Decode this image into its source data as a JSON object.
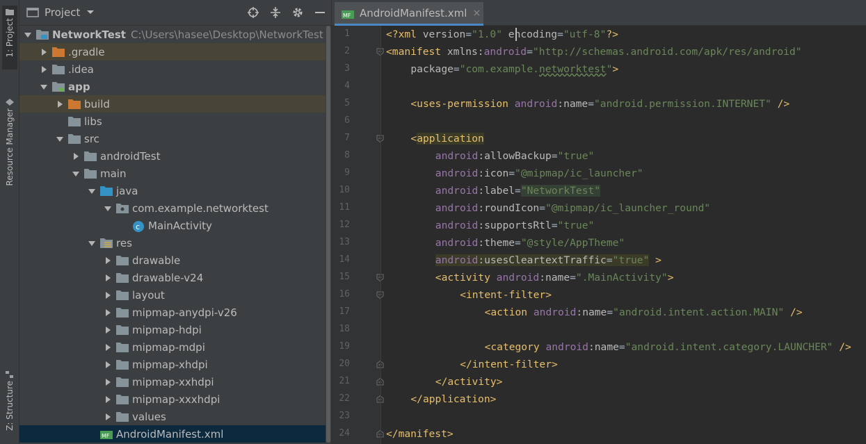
{
  "strip": {
    "project_tab": "1: Project",
    "resource_tab": "Resource Manager",
    "structure_tab": "Z: Structure"
  },
  "project_panel": {
    "title": "Project",
    "icons": [
      "target-icon",
      "collapse-icon",
      "gear-icon",
      "minimize-icon"
    ],
    "tree": [
      {
        "label": "NetworkTest",
        "path": "C:\\Users\\hasee\\Desktop\\NetworkTest",
        "depth": 0,
        "arrow": "down",
        "icon": "module-folder",
        "bold": true
      },
      {
        "label": ".gradle",
        "depth": 1,
        "arrow": "right",
        "icon": "orange-folder",
        "highlight": true
      },
      {
        "label": ".idea",
        "depth": 1,
        "arrow": "right",
        "icon": "folder"
      },
      {
        "label": "app",
        "depth": 1,
        "arrow": "down",
        "icon": "module-folder-green",
        "bold": true
      },
      {
        "label": "build",
        "depth": 2,
        "arrow": "right",
        "icon": "orange-folder",
        "highlight": true
      },
      {
        "label": "libs",
        "depth": 2,
        "arrow": "none",
        "icon": "folder"
      },
      {
        "label": "src",
        "depth": 2,
        "arrow": "down",
        "icon": "folder"
      },
      {
        "label": "androidTest",
        "depth": 3,
        "arrow": "right",
        "icon": "folder"
      },
      {
        "label": "main",
        "depth": 3,
        "arrow": "down",
        "icon": "folder"
      },
      {
        "label": "java",
        "depth": 4,
        "arrow": "down",
        "icon": "blue-folder"
      },
      {
        "label": "com.example.networktest",
        "depth": 5,
        "arrow": "down",
        "icon": "package-folder"
      },
      {
        "label": "MainActivity",
        "depth": 6,
        "arrow": "none",
        "icon": "class-c"
      },
      {
        "label": "res",
        "depth": 4,
        "arrow": "down",
        "icon": "res-folder"
      },
      {
        "label": "drawable",
        "depth": 5,
        "arrow": "right",
        "icon": "folder"
      },
      {
        "label": "drawable-v24",
        "depth": 5,
        "arrow": "right",
        "icon": "folder"
      },
      {
        "label": "layout",
        "depth": 5,
        "arrow": "right",
        "icon": "folder"
      },
      {
        "label": "mipmap-anydpi-v26",
        "depth": 5,
        "arrow": "right",
        "icon": "folder"
      },
      {
        "label": "mipmap-hdpi",
        "depth": 5,
        "arrow": "right",
        "icon": "folder"
      },
      {
        "label": "mipmap-mdpi",
        "depth": 5,
        "arrow": "right",
        "icon": "folder"
      },
      {
        "label": "mipmap-xhdpi",
        "depth": 5,
        "arrow": "right",
        "icon": "folder"
      },
      {
        "label": "mipmap-xxhdpi",
        "depth": 5,
        "arrow": "right",
        "icon": "folder"
      },
      {
        "label": "mipmap-xxxhdpi",
        "depth": 5,
        "arrow": "right",
        "icon": "folder"
      },
      {
        "label": "values",
        "depth": 5,
        "arrow": "right",
        "icon": "folder"
      },
      {
        "label": "AndroidManifest.xml",
        "depth": 4,
        "arrow": "none",
        "icon": "manifest",
        "selected": true
      }
    ]
  },
  "editor": {
    "tab": {
      "label": "AndroidManifest.xml",
      "close": "×",
      "badge": "MF"
    },
    "line_numbers": [
      "1",
      "2",
      "3",
      "4",
      "5",
      "6",
      "7",
      "8",
      "9",
      "10",
      "11",
      "12",
      "13",
      "14",
      "15",
      "16",
      "17",
      "18",
      "19",
      "20",
      "21",
      "22",
      "23",
      "24"
    ],
    "lines": [
      [
        [
          "p",
          "<?"
        ],
        [
          "t",
          "xml "
        ],
        [
          "at",
          "version"
        ],
        [
          "",
          "="
        ],
        [
          "v",
          "\"1.0\""
        ],
        [
          "",
          " "
        ],
        [
          "at",
          "encoding"
        ],
        [
          "",
          "="
        ],
        [
          "v",
          "\"utf-8\""
        ],
        [
          "p",
          "?>"
        ]
      ],
      [
        [
          "t",
          "<manifest "
        ],
        [
          "at",
          "xmlns:"
        ],
        [
          "ns",
          "android"
        ],
        [
          "",
          "="
        ],
        [
          "v",
          "\"http://schemas.android.com/apk/res/android\""
        ]
      ],
      [
        [
          "",
          " "
        ],
        [
          "at",
          "package"
        ],
        [
          "",
          "="
        ],
        [
          "v",
          "\"com.example."
        ],
        [
          "vul",
          "networktest"
        ],
        [
          "v",
          "\""
        ],
        [
          "t",
          ">"
        ]
      ],
      [],
      [
        [
          "",
          " "
        ],
        [
          "t",
          "<uses-permission "
        ],
        [
          "ns",
          "android"
        ],
        [
          "at",
          ":name"
        ],
        [
          "",
          "="
        ],
        [
          "v",
          "\"android.permission.INTERNET\""
        ],
        [
          "",
          " "
        ],
        [
          "t",
          "/>"
        ]
      ],
      [],
      [
        [
          "",
          " "
        ],
        [
          "t",
          "<"
        ],
        [
          "th",
          "application"
        ]
      ],
      [
        [
          "",
          " "
        ],
        [
          "ns",
          "android"
        ],
        [
          "at",
          ":allowBackup"
        ],
        [
          "",
          "="
        ],
        [
          "v",
          "\"true\""
        ]
      ],
      [
        [
          "",
          " "
        ],
        [
          "ns",
          "android"
        ],
        [
          "at",
          ":icon"
        ],
        [
          "",
          "="
        ],
        [
          "v",
          "\"@mipmap/ic_launcher\""
        ]
      ],
      [
        [
          "",
          " "
        ],
        [
          "ns",
          "android"
        ],
        [
          "at",
          ":label"
        ],
        [
          "",
          "="
        ],
        [
          "vlbl",
          "\"NetworkTest\""
        ]
      ],
      [
        [
          "",
          " "
        ],
        [
          "ns",
          "android"
        ],
        [
          "at",
          ":roundIcon"
        ],
        [
          "",
          "="
        ],
        [
          "v",
          "\"@mipmap/ic_launcher_round\""
        ]
      ],
      [
        [
          "",
          " "
        ],
        [
          "ns",
          "android"
        ],
        [
          "at",
          ":supportsRtl"
        ],
        [
          "",
          "="
        ],
        [
          "v",
          "\"true\""
        ]
      ],
      [
        [
          "",
          " "
        ],
        [
          "ns",
          "android"
        ],
        [
          "at",
          ":theme"
        ],
        [
          "",
          "="
        ],
        [
          "v",
          "\"@style/AppTheme\""
        ]
      ],
      [
        [
          "",
          " "
        ],
        [
          "nsh",
          "android"
        ],
        [
          "ath",
          ":usesCleartextTraffic"
        ],
        [
          "h",
          "="
        ],
        [
          "vh",
          "\"true\""
        ],
        [
          "",
          " "
        ],
        [
          "t",
          ">"
        ]
      ],
      [
        [
          "",
          " "
        ],
        [
          "t",
          "<activity "
        ],
        [
          "ns",
          "android"
        ],
        [
          "at",
          ":name"
        ],
        [
          "",
          "="
        ],
        [
          "v",
          "\".MainActivity\""
        ],
        [
          "t",
          ">"
        ]
      ],
      [
        [
          "",
          " "
        ],
        [
          "t",
          "<intent-filter>"
        ]
      ],
      [
        [
          "",
          " "
        ],
        [
          "t",
          "<action "
        ],
        [
          "ns",
          "android"
        ],
        [
          "at",
          ":name"
        ],
        [
          "",
          "="
        ],
        [
          "v",
          "\"android.intent.action.MAIN\""
        ],
        [
          "",
          " "
        ],
        [
          "t",
          "/>"
        ]
      ],
      [],
      [
        [
          "",
          " "
        ],
        [
          "t",
          "<category "
        ],
        [
          "ns",
          "android"
        ],
        [
          "at",
          ":name"
        ],
        [
          "",
          "="
        ],
        [
          "v",
          "\"android.intent.category.LAUNCHER\""
        ],
        [
          "",
          " "
        ],
        [
          "t",
          "/>"
        ]
      ],
      [
        [
          "",
          " "
        ],
        [
          "t",
          "</intent-filter>"
        ]
      ],
      [
        [
          "",
          " "
        ],
        [
          "t",
          "</activity>"
        ]
      ],
      [
        [
          "",
          " "
        ],
        [
          "t",
          "</application>"
        ]
      ],
      [],
      [
        [
          "t",
          "</manifest>"
        ]
      ]
    ],
    "indents": [
      0,
      0,
      4,
      0,
      4,
      0,
      4,
      8,
      8,
      8,
      8,
      8,
      8,
      8,
      8,
      12,
      16,
      0,
      16,
      12,
      8,
      4,
      0,
      0
    ]
  }
}
